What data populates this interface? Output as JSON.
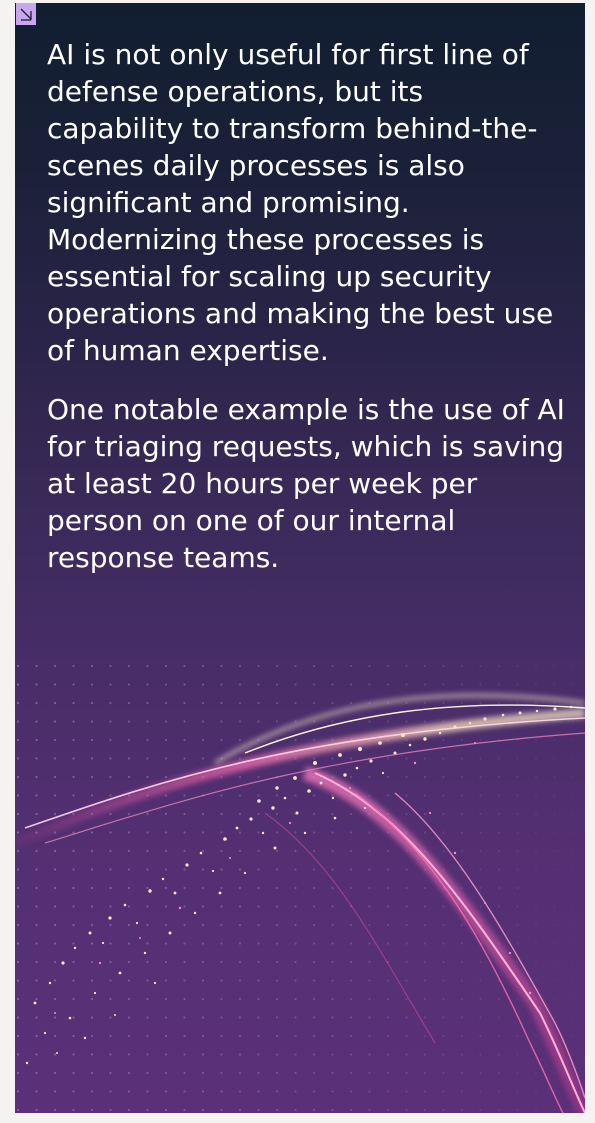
{
  "badge": {
    "icon": "arrow-down-right-icon",
    "color": "#c9a7ee"
  },
  "body": {
    "paragraph_1": "AI is not only useful for first line of defense operations, but its capability to transform behind-the-scenes daily processes is also significant and promising. Modernizing these processes is essential for scaling up security operations and making the best use of human expertise.",
    "paragraph_2": "One notable example is the use of AI for triaging requests, which is saving at least 20 hours per week per person on one of our internal response teams."
  },
  "colors": {
    "background_top": "#111e30",
    "background_bottom": "#5b3079",
    "accent_pink": "#e84aa0",
    "accent_cream": "#f5e6c8"
  }
}
